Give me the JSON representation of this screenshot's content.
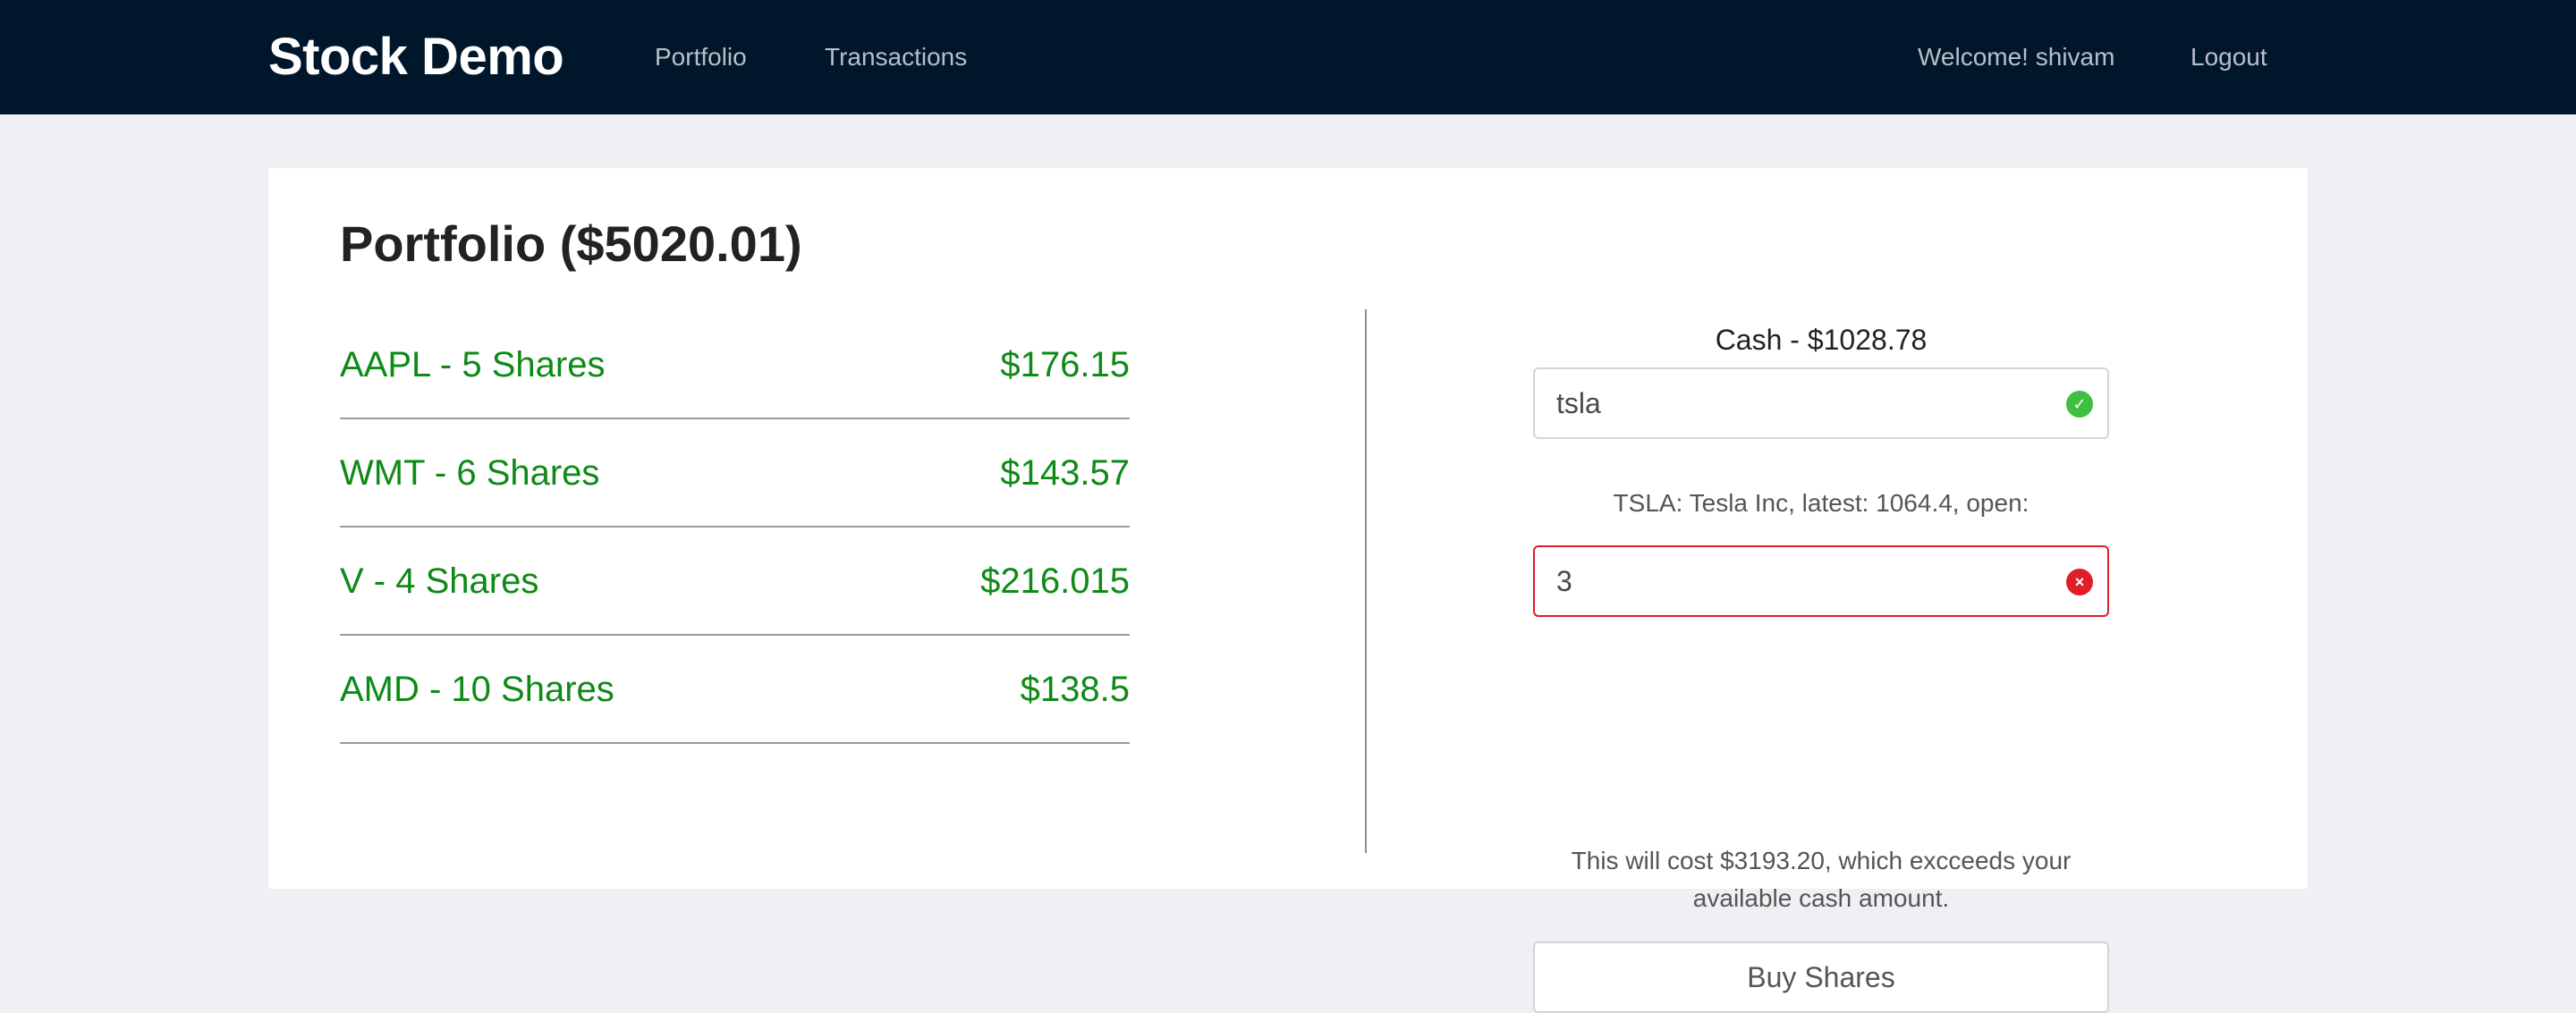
{
  "navbar": {
    "brand": "Stock Demo",
    "links": [
      "Portfolio",
      "Transactions"
    ],
    "welcome": "Welcome! shivam",
    "logout": "Logout"
  },
  "portfolio": {
    "title": "Portfolio ($5020.01)",
    "holdings": [
      {
        "label": "AAPL - 5 Shares",
        "value": "$176.15"
      },
      {
        "label": "WMT - 6 Shares",
        "value": "$143.57"
      },
      {
        "label": "V - 4 Shares",
        "value": "$216.015"
      },
      {
        "label": "AMD - 10 Shares",
        "value": "$138.5"
      }
    ]
  },
  "trade": {
    "cash": "Cash - $1028.78",
    "ticker_value": "tsla",
    "quote_text": "TSLA: Tesla Inc, latest: 1064.4, open:",
    "quantity_value": "3",
    "cost_message": "This will cost $3193.20, which excceeds your available cash amount.",
    "buy_label": "Buy Shares"
  },
  "icons": {
    "valid": "check-circle-icon",
    "invalid": "x-circle-icon"
  },
  "colors": {
    "navbar_bg": "#00162b",
    "holding_text": "#0e8a16",
    "invalid_border": "#e11d2a",
    "valid_icon": "#3fbf3f"
  }
}
